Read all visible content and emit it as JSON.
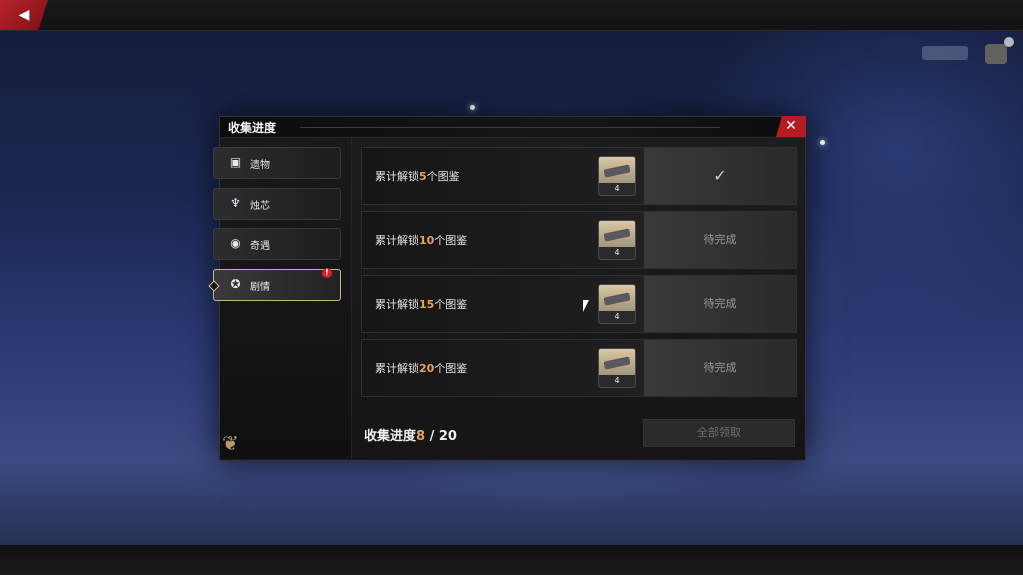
{
  "colors": {
    "accent": "#b51c22",
    "highlight": "#e8a35a",
    "gold": "#c9b787"
  },
  "dialog": {
    "title": "收集进度"
  },
  "sidebar": {
    "tabs": [
      {
        "label": "遗物",
        "icon": "briefcase-icon",
        "active": false
      },
      {
        "label": "烛芯",
        "icon": "wick-icon",
        "active": false
      },
      {
        "label": "奇遇",
        "icon": "encounter-icon",
        "active": false
      },
      {
        "label": "剧情",
        "icon": "film-reel-icon",
        "active": true,
        "alert": "!"
      }
    ]
  },
  "rows": [
    {
      "prefix": "累计解锁",
      "num": "5",
      "suffix": "个图鉴",
      "reward_count": "4",
      "status": "✓",
      "done": true
    },
    {
      "prefix": "累计解锁",
      "num": "10",
      "suffix": "个图鉴",
      "reward_count": "4",
      "status": "待完成",
      "done": false
    },
    {
      "prefix": "累计解锁",
      "num": "15",
      "suffix": "个图鉴",
      "reward_count": "4",
      "status": "待完成",
      "done": false
    },
    {
      "prefix": "累计解锁",
      "num": "20",
      "suffix": "个图鉴",
      "reward_count": "4",
      "status": "待完成",
      "done": false
    }
  ],
  "footer": {
    "progress_label": "收集进度",
    "current": "8",
    "total": " / 20",
    "claim_all": "全部领取"
  }
}
